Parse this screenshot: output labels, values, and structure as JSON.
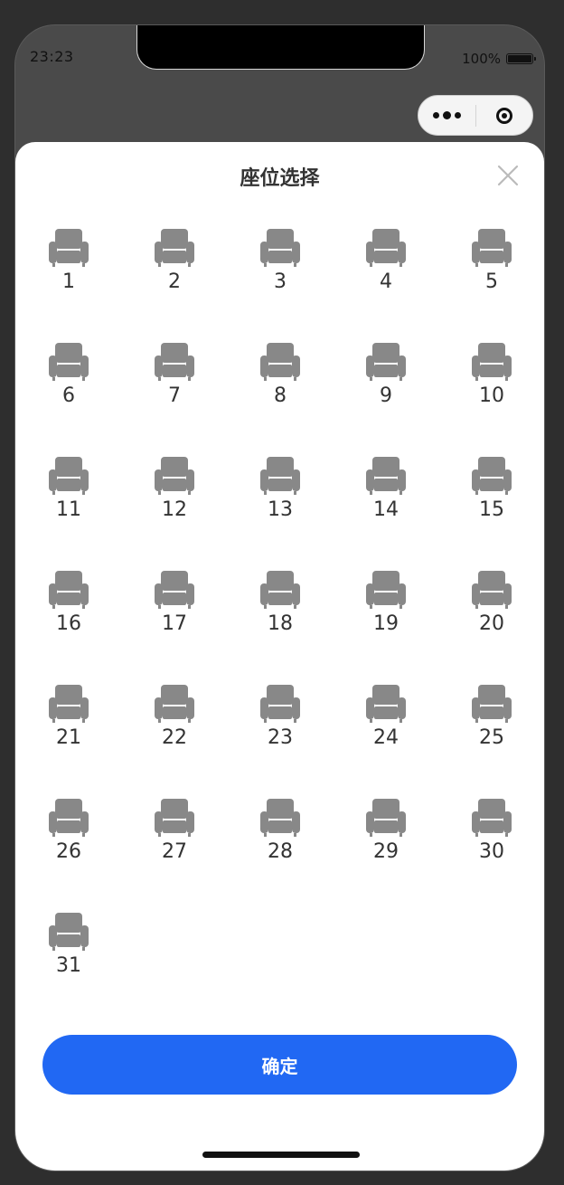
{
  "status_bar": {
    "time": "23:23",
    "battery_text": "100%"
  },
  "capsule": {
    "icons": [
      "more-dots-icon",
      "target-close-icon"
    ]
  },
  "sheet": {
    "title": "座位选择",
    "close_icon": "close-x-icon"
  },
  "seats": [
    "1",
    "2",
    "3",
    "4",
    "5",
    "6",
    "7",
    "8",
    "9",
    "10",
    "11",
    "12",
    "13",
    "14",
    "15",
    "16",
    "17",
    "18",
    "19",
    "20",
    "21",
    "22",
    "23",
    "24",
    "25",
    "26",
    "27",
    "28",
    "29",
    "30",
    "31"
  ],
  "seat_icon": "armchair-icon",
  "confirm_label": "确定",
  "colors": {
    "accent": "#2168f3",
    "seat": "#888888",
    "text": "#333333",
    "close": "#bbbbbb"
  }
}
